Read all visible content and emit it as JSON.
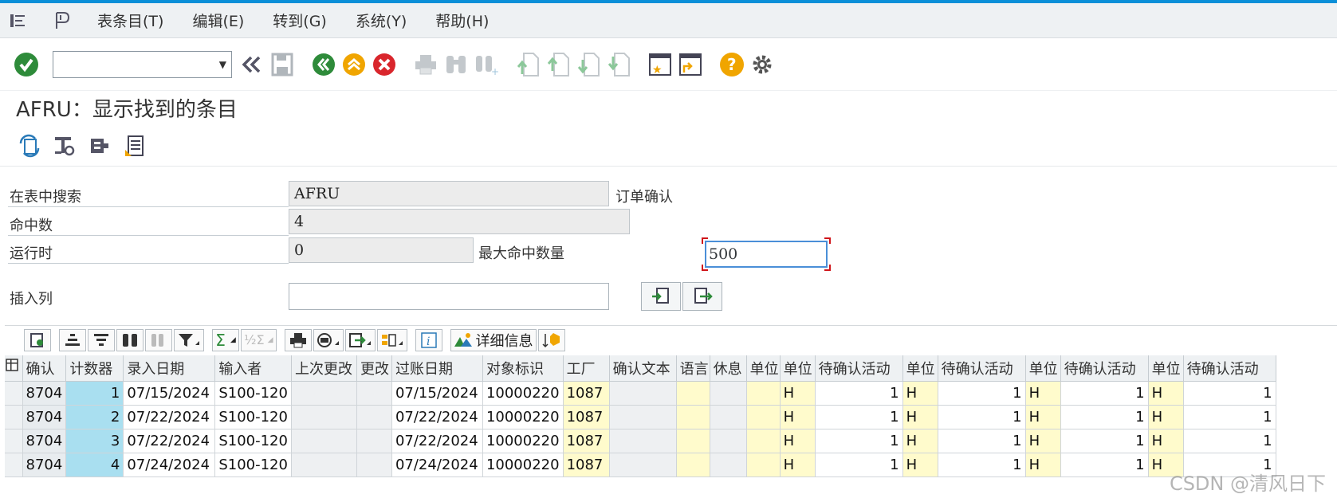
{
  "menu": {
    "items": [
      {
        "label": "表条目(T)"
      },
      {
        "label": "编辑(E)"
      },
      {
        "label": "转到(G)"
      },
      {
        "label": "系统(Y)"
      },
      {
        "label": "帮助(H)"
      }
    ]
  },
  "toolbar": {
    "command_value": "",
    "icons": [
      "check-icon",
      "back-double-icon",
      "save-icon",
      "back-icon",
      "exit-icon",
      "cancel-icon",
      "print-icon",
      "find-icon",
      "find-next-icon",
      "first-page-icon",
      "prev-page-icon",
      "next-page-icon",
      "last-page-icon",
      "create-session-icon",
      "shortcut-icon",
      "help-icon",
      "settings-icon"
    ]
  },
  "title": "AFRU：显示找到的条目",
  "form": {
    "search_table_label": "在表中搜索",
    "search_table_value": "AFRU",
    "search_table_desc": "订单确认",
    "hits_label": "命中数",
    "hits_value": "4",
    "runtime_label": "运行时",
    "runtime_value": "0",
    "max_hits_label": "最大命中数量",
    "max_hits_value": "500",
    "insert_col_label": "插入列",
    "insert_col_value": ""
  },
  "grid_toolbar": {
    "details_label": "详细信息"
  },
  "grid": {
    "columns": [
      "确认",
      "计数器",
      "录入日期",
      "输入者",
      "上次更改",
      "更改",
      "过账日期",
      "对象标识",
      "工厂",
      "确认文本",
      "语言",
      "休息",
      "单位",
      "单位",
      "待确认活动",
      "单位",
      "待确认活动",
      "单位",
      "待确认活动",
      "单位",
      "待确认活动"
    ],
    "rows": [
      [
        "8704",
        "1",
        "07/15/2024",
        "S100-120",
        "",
        "",
        "07/15/2024",
        "10000220",
        "1087",
        "",
        "",
        "",
        "",
        "H",
        "1",
        "H",
        "1",
        "H",
        "1",
        "H",
        "1"
      ],
      [
        "8704",
        "2",
        "07/22/2024",
        "S100-120",
        "",
        "",
        "07/22/2024",
        "10000220",
        "1087",
        "",
        "",
        "",
        "",
        "H",
        "1",
        "H",
        "1",
        "H",
        "1",
        "H",
        "1"
      ],
      [
        "8704",
        "3",
        "07/22/2024",
        "S100-120",
        "",
        "",
        "07/22/2024",
        "10000220",
        "1087",
        "",
        "",
        "",
        "",
        "H",
        "1",
        "H",
        "1",
        "H",
        "1",
        "H",
        "1"
      ],
      [
        "8704",
        "4",
        "07/24/2024",
        "S100-120",
        "",
        "",
        "07/24/2024",
        "10000220",
        "1087",
        "",
        "",
        "",
        "",
        "H",
        "1",
        "H",
        "1",
        "H",
        "1",
        "H",
        "1"
      ]
    ]
  },
  "watermark": "CSDN @清风日下"
}
